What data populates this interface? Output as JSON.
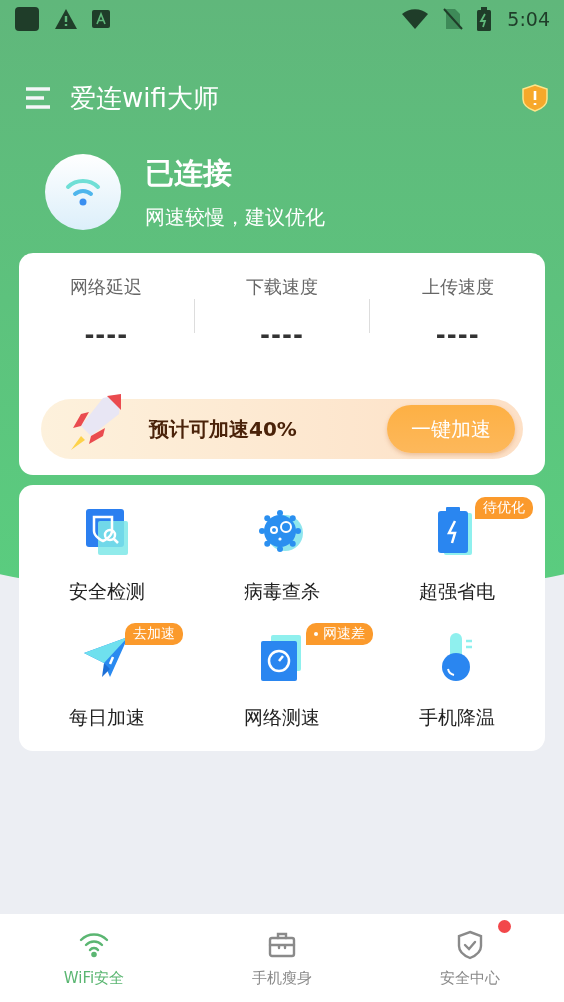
{
  "status_bar": {
    "time": "5:04"
  },
  "app_bar": {
    "title": "爱连wifi大师"
  },
  "connection": {
    "status": "已连接",
    "hint": "网速较慢，建议优化"
  },
  "stats": [
    {
      "label": "网络延迟",
      "value": "----"
    },
    {
      "label": "下载速度",
      "value": "----"
    },
    {
      "label": "上传速度",
      "value": "----"
    }
  ],
  "boost": {
    "text": "预计可加速40%",
    "button": "一键加速"
  },
  "features": [
    {
      "kind": "scan",
      "label": "安全检测"
    },
    {
      "kind": "virus",
      "label": "病毒查杀"
    },
    {
      "kind": "battery",
      "label": "超强省电",
      "badge": {
        "text": "待优化",
        "dot": false
      }
    },
    {
      "kind": "plane",
      "label": "每日加速",
      "badge": {
        "text": "去加速",
        "dot": false
      }
    },
    {
      "kind": "speed",
      "label": "网络测速",
      "badge": {
        "text": "网速差",
        "dot": true
      }
    },
    {
      "kind": "thermo",
      "label": "手机降温"
    }
  ],
  "bottom_nav": [
    {
      "kind": "wifi",
      "label": "WiFi安全",
      "selected": true,
      "notification": false
    },
    {
      "kind": "toolbox",
      "label": "手机瘦身",
      "selected": false,
      "notification": false
    },
    {
      "kind": "shield",
      "label": "安全中心",
      "selected": false,
      "notification": true
    }
  ]
}
